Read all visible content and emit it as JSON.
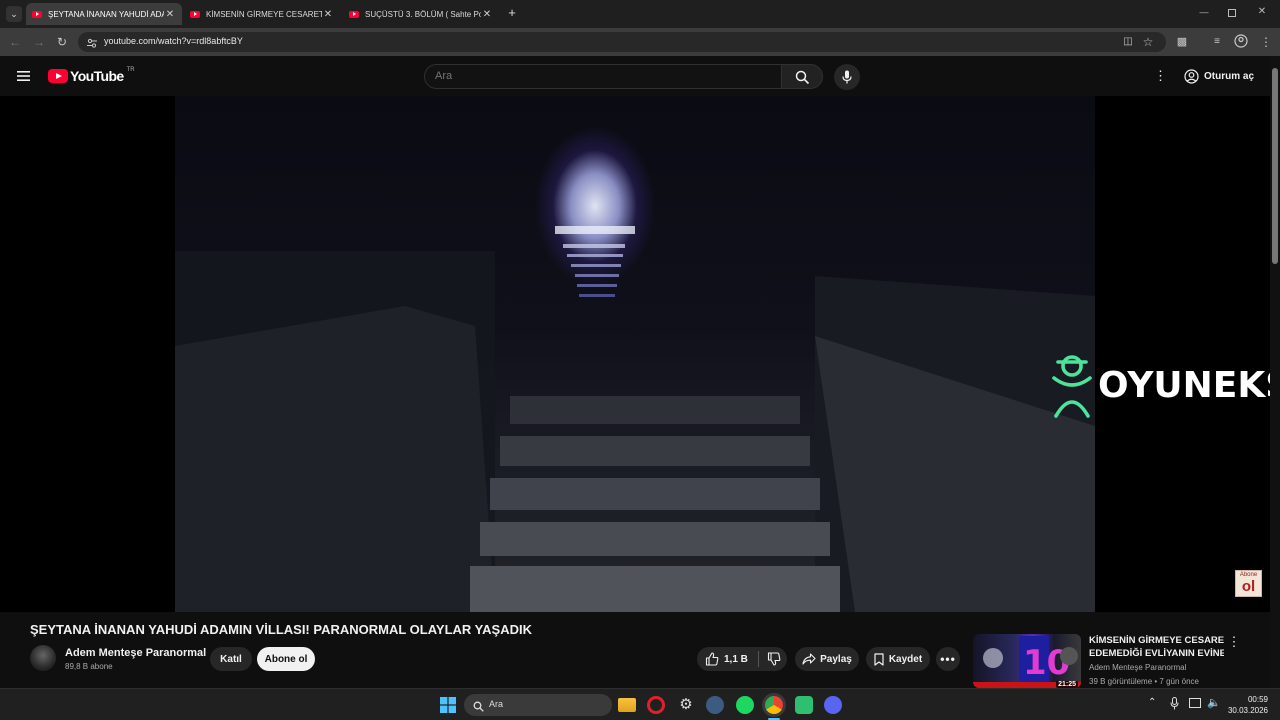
{
  "browser": {
    "tabs": [
      {
        "title": "ŞEYTANA İNANAN YAHUDİ ADA",
        "active": true
      },
      {
        "title": "KİMSENİN GİRMEYE CESARET E",
        "active": false
      },
      {
        "title": "SUÇÜSTÜ 3. BÖLÜM ( Sahte Po",
        "active": false
      }
    ],
    "url": "youtube.com/watch?v=rdl8abftcBY"
  },
  "youtube": {
    "logo_text": "YouTube",
    "region": "TR",
    "search_placeholder": "Ara",
    "sign_in_label": "Oturum aç"
  },
  "video": {
    "watermark": "OYUNEKS",
    "corner_badge": {
      "top": "Abone",
      "bottom": "ol"
    },
    "title": "ŞEYTANA İNANAN YAHUDİ ADAMIN VİLLASI! PARANORMAL OLAYLAR YAŞADIK",
    "channel": "Adem Menteşe Paranormal",
    "subscribers": "89,8 B abone",
    "join_label": "Katıl",
    "subscribe_label": "Abone ol",
    "likes": "1,1 B",
    "share_label": "Paylaş",
    "save_label": "Kaydet"
  },
  "suggestion": {
    "title_line1": "KİMSENİN GİRMEYE CESARET",
    "title_line2": "EDEMEDİĞİ EVLİYANIN EVİNE ...",
    "channel": "Adem Menteşe Paranormal",
    "meta": "39 B görüntüleme • 7 gün önce",
    "duration": "21:25"
  },
  "taskbar": {
    "search_label": "Ara",
    "time": "00:59",
    "date": "30.03.2026"
  },
  "colors": {
    "youtube_red": "#ff0033",
    "watermark_green": "#4be49a"
  }
}
